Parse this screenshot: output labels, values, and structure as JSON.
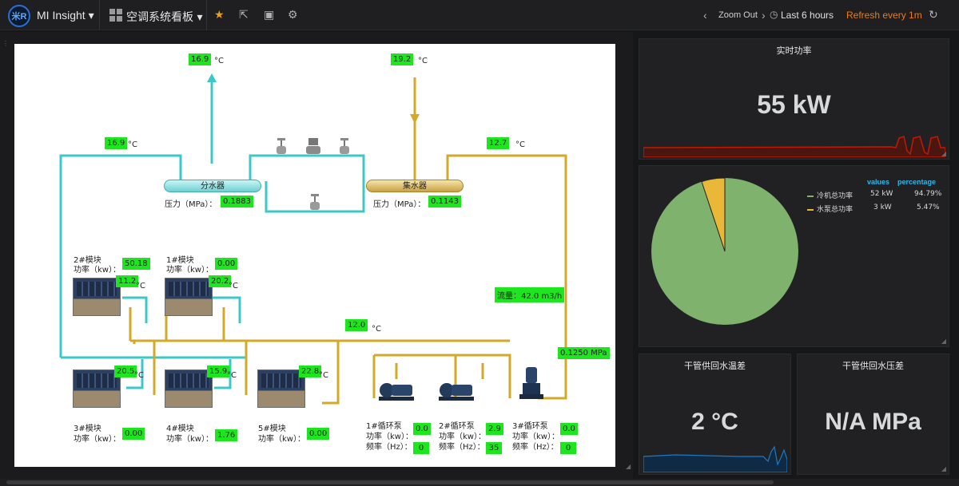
{
  "topbar": {
    "logo_text": "米R",
    "brand": "MI Insight ▾",
    "dashboard_title": "空调系统看板 ▾",
    "zoom_out": "Zoom Out",
    "time_range": "Last 6 hours",
    "refresh": "Refresh every 1m",
    "icons": [
      "star-icon",
      "share-icon",
      "save-icon",
      "gear-icon",
      "chevron-left-icon",
      "chevron-right-icon",
      "clock-icon",
      "refresh-icon"
    ]
  },
  "diagram": {
    "supply_top_temp": "16.9",
    "return_top_temp": "19.2",
    "supply_left_temp": "16.9",
    "return_right_temp": "12.7",
    "unit_c": "°C",
    "distributor_label": "分水器",
    "collector_label": "集水器",
    "distributor_pressure_label": "压力（MPa）：",
    "distributor_pressure": "0.1883",
    "collector_pressure_label": "压力（MPa）：",
    "collector_pressure": "0.1143",
    "flow_label": "流量：42.0 m3/h",
    "mid_temp": "12.0",
    "pipe_pressure": "0.1250 MPa",
    "modules": [
      {
        "name": "2#模块",
        "power_label": "功率（kw）：",
        "power": "50.18",
        "temp": "11.2"
      },
      {
        "name": "1#模块",
        "power_label": "功率（kw）：",
        "power": "0.00",
        "temp": "20.2"
      },
      {
        "name": "3#模块",
        "power_label": "功率（kw）：",
        "power": "0.00",
        "temp": "20.5"
      },
      {
        "name": "4#模块",
        "power_label": "功率（kw）：",
        "power": "1.76",
        "temp": "15.9"
      },
      {
        "name": "5#模块",
        "power_label": "功率（kw）：",
        "power": "0.00",
        "temp": "22.8"
      }
    ],
    "pumps": [
      {
        "name": "1#循环泵",
        "power_label": "功率（kw）：",
        "power": "0.0",
        "freq_label": "频率（Hz）：",
        "freq": "0"
      },
      {
        "name": "2#循环泵",
        "power_label": "功率（kw）：",
        "power": "2.9",
        "freq_label": "频率（Hz）：",
        "freq": "35"
      },
      {
        "name": "3#循环泵",
        "power_label": "功率（kw）：",
        "power": "0.0",
        "freq_label": "频率（Hz）：",
        "freq": "0"
      }
    ]
  },
  "panels": {
    "realtime": {
      "title": "实时功率",
      "value": "55 kW"
    },
    "pie": {
      "col_values": "values",
      "col_percentage": "percentage",
      "rows": [
        {
          "name": "冷机总功率",
          "value": "52 kW",
          "percent": "94.79%",
          "color": "#7eb26d"
        },
        {
          "name": "水泵总功率",
          "value": "3 kW",
          "percent": "5.47%",
          "color": "#eab839"
        }
      ]
    },
    "temp_diff": {
      "title": "干管供回水温差",
      "value": "2 °C"
    },
    "press_diff": {
      "title": "干管供回水压差",
      "value": "N/A MPa"
    }
  },
  "colors": {
    "cyan_pipe": "#3cc8c8",
    "yellow_pipe": "#d4a92a",
    "tag_green": "#1ee61e",
    "spark_red": "#bf1b00",
    "spark_blue": "#1f78c1",
    "accent_orange": "#eb7b18"
  }
}
